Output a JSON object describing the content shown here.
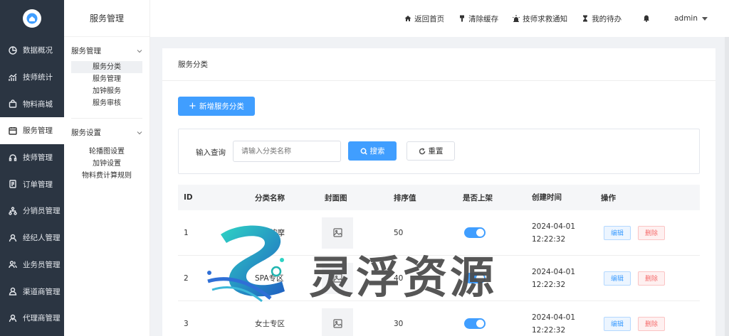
{
  "sidebar": {
    "items": [
      {
        "label": "数据概况",
        "icon": "pie-chart-icon"
      },
      {
        "label": "技师统计",
        "icon": "trend-chart-icon"
      },
      {
        "label": "物料商城",
        "icon": "shopping-bag-icon"
      },
      {
        "label": "服务管理",
        "icon": "calendar-icon",
        "active": true
      },
      {
        "label": "技师管理",
        "icon": "headset-icon"
      },
      {
        "label": "订单管理",
        "icon": "document-icon"
      },
      {
        "label": "分销员管理",
        "icon": "network-icon"
      },
      {
        "label": "经纪人管理",
        "icon": "user-icon"
      },
      {
        "label": "业务员管理",
        "icon": "users-icon"
      },
      {
        "label": "渠道商管理",
        "icon": "user-group-icon"
      },
      {
        "label": "代理商管理",
        "icon": "agent-icon"
      }
    ]
  },
  "subnav": {
    "title": "服务管理",
    "group1": {
      "label": "服务管理",
      "items": [
        "服务分类",
        "服务管理",
        "加钟服务",
        "服务审核"
      ]
    },
    "group2": {
      "label": "服务设置",
      "items": [
        "轮播图设置",
        "加钟设置",
        "物料费计算规则"
      ]
    }
  },
  "header": {
    "home": "返回首页",
    "clear_cache": "清除缓存",
    "sos": "技师求救通知",
    "todo": "我的待办",
    "user": "admin"
  },
  "card": {
    "title": "服务分类",
    "add_button": "新增服务分类",
    "query": {
      "label": "输入查询",
      "placeholder": "请输入分类名称",
      "search": "搜索",
      "reset": "重置"
    }
  },
  "table": {
    "columns": [
      "ID",
      "分类名称",
      "封面图",
      "排序值",
      "是否上架",
      "创建时间",
      "操作"
    ],
    "rows": [
      {
        "id": "1",
        "name": "保健按摩",
        "sort": "50",
        "on_shelf": true,
        "date": "2024-04-01",
        "time": "12:22:32",
        "edit": "编辑",
        "delete": "删除"
      },
      {
        "id": "2",
        "name": "SPA专区",
        "sort": "40",
        "on_shelf": true,
        "date": "2024-04-01",
        "time": "12:22:32",
        "edit": "编辑",
        "delete": "删除"
      },
      {
        "id": "3",
        "name": "女士专区",
        "sort": "30",
        "on_shelf": true,
        "date": "2024-04-01",
        "time": "12:22:32",
        "edit": "编辑",
        "delete": "删除"
      }
    ]
  },
  "watermark": {
    "text": "灵浮资源"
  },
  "colors": {
    "sidebar_bg": "#2b3542",
    "primary": "#409eff",
    "danger": "#f56c6c"
  }
}
